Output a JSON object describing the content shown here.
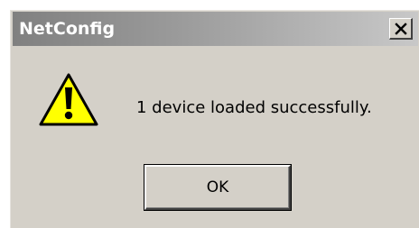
{
  "window": {
    "title": "NetConfig",
    "close_glyph": "X"
  },
  "dialog": {
    "icon": "warning-icon",
    "message": "1 device loaded successfully.",
    "ok_label": "OK"
  },
  "colors": {
    "face": "#d4d0c8",
    "title_start": "#808080",
    "title_end": "#c8c8c8",
    "warning_fill": "#ffff00"
  }
}
